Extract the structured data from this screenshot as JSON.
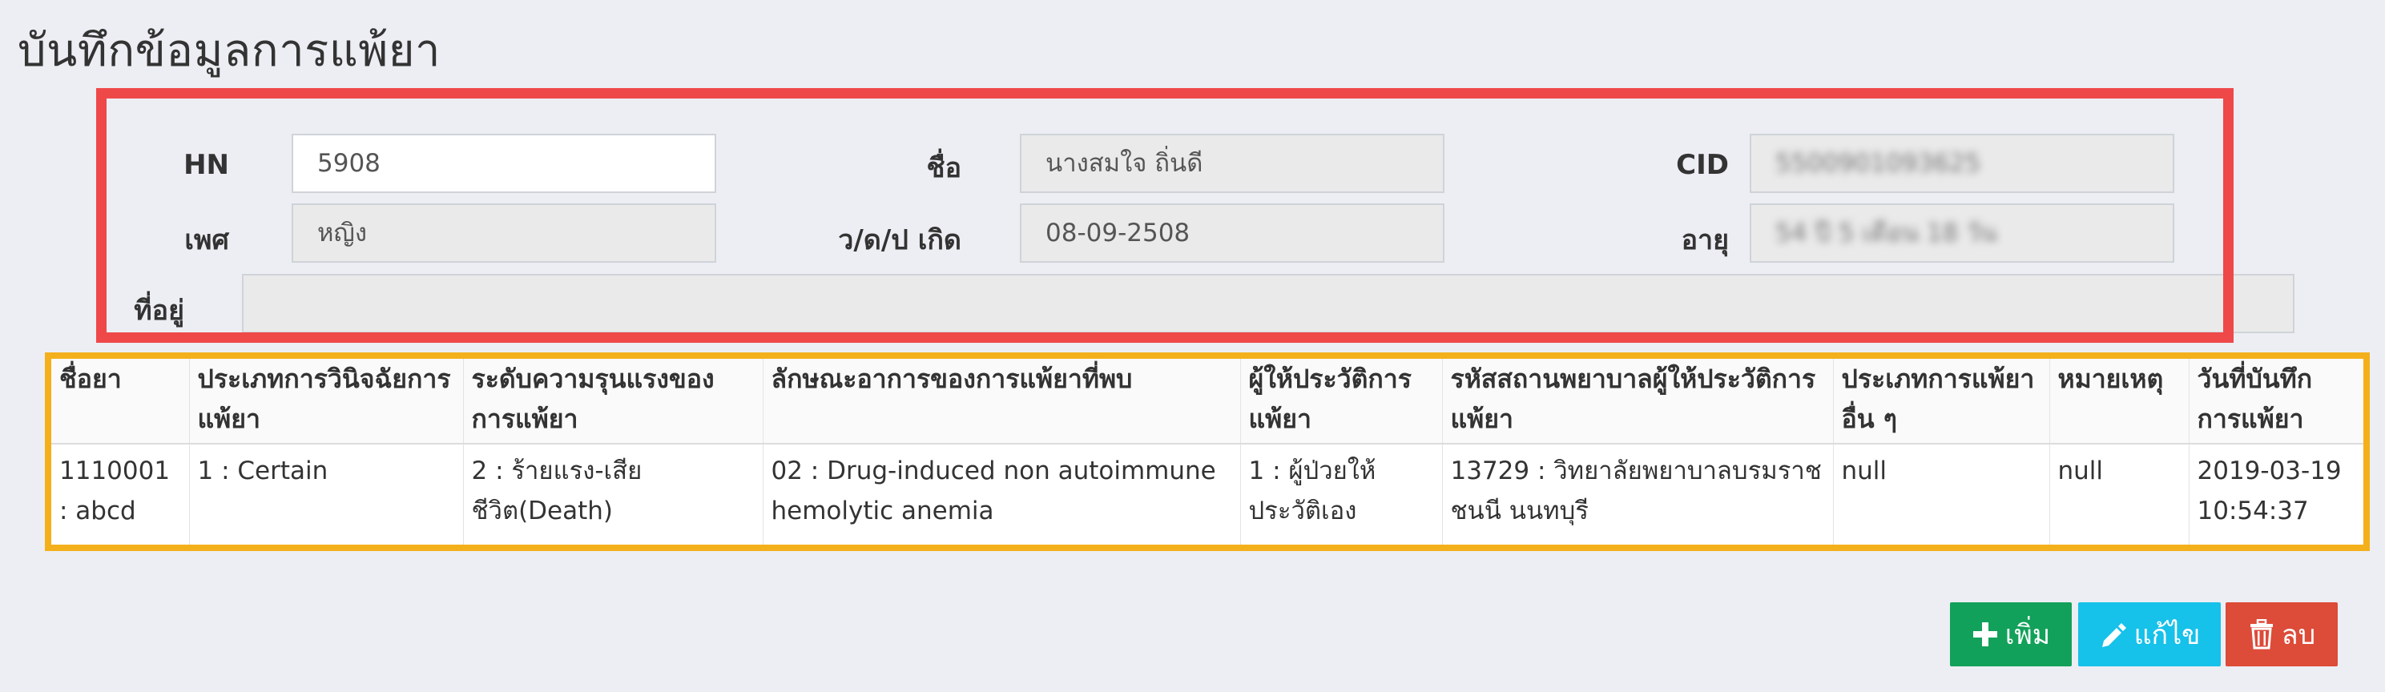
{
  "page_title": "บันทึกข้อมูลการแพ้ยา",
  "patient": {
    "hn_label": "HN",
    "hn_value": "5908",
    "name_label": "ชื่อ",
    "name_value": "นางสมใจ ถิ่นดี",
    "cid_label": "CID",
    "cid_value": "5500901093625",
    "sex_label": "เพศ",
    "sex_value": "หญิง",
    "dob_label": "ว/ด/ป เกิด",
    "dob_value": "08-09-2508",
    "age_label": "อายุ",
    "age_value": "54 ปี 5 เดือน 18 วัน",
    "address_label": "ที่อยู่",
    "address_value": ""
  },
  "table": {
    "headers": [
      "ชื่อยา",
      "ประเภทการวินิจฉัยการแพ้ยา",
      "ระดับความรุนแรงของการแพ้ยา",
      "ลักษณะอาการของการแพ้ยาที่พบ",
      "ผู้ให้ประวัติการแพ้ยา",
      "รหัสสถานพยาบาลผู้ให้ประวัติการแพ้ยา",
      "ประเภทการแพ้ยาอื่น ๆ",
      "หมายเหตุ",
      "วันที่บันทึกการแพ้ยา"
    ],
    "rows": [
      [
        "1110001 : abcd",
        "1 : Certain",
        "2 : ร้ายแรง-เสียชีวิต(Death)",
        "02 : Drug-induced non autoimmune hemolytic anemia",
        "1 : ผู้ป่วยให้ประวัติเอง",
        "13729 : วิทยาลัยพยาบาลบรมราชชนนี นนทบุรี",
        "null",
        "null",
        "2019-03-19 10:54:37"
      ]
    ]
  },
  "buttons": {
    "add": "เพิ่ม",
    "edit": "แก้ไข",
    "delete": "ลบ"
  },
  "colors": {
    "add": "#12a15a",
    "edit": "#16c1ea",
    "delete": "#dd4b39",
    "annotation_red": "#ef4849",
    "annotation_orange": "#f4b01b"
  },
  "icons": [
    "plus-icon",
    "pencil-icon",
    "trash-icon"
  ]
}
